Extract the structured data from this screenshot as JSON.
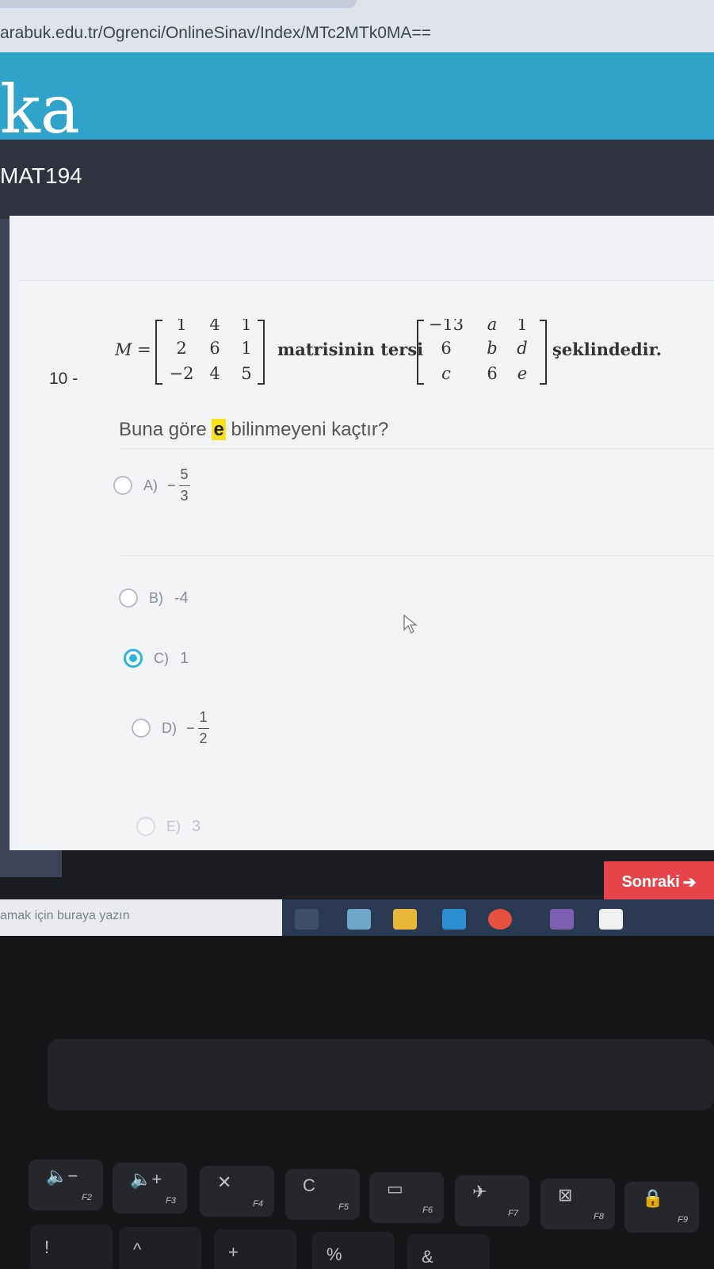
{
  "browser": {
    "url": "arabuk.edu.tr/Ogrenci/OnlineSinav/Index/MTc2MTk0MA=="
  },
  "header": {
    "logo_text": "ka",
    "course_code": "MAT194"
  },
  "question": {
    "number": "10 -",
    "matrix_label": "M =",
    "matrix_M": [
      [
        "1",
        "4",
        "1"
      ],
      [
        "2",
        "6",
        "1"
      ],
      [
        "−2",
        "4",
        "5"
      ]
    ],
    "text_middle": "matrisinin tersi",
    "matrix_inverse": [
      [
        "−13",
        "a",
        "1"
      ],
      [
        "6",
        "b",
        "d"
      ],
      [
        "c",
        "6",
        "e"
      ]
    ],
    "text_end": "şeklindedir.",
    "prompt_before": "Buna göre",
    "prompt_highlight": "e",
    "prompt_after": "bilinmeyeni kaçtır?"
  },
  "options": [
    {
      "letter": "A)",
      "value": "",
      "frac_sign": "−",
      "frac_num": "5",
      "frac_den": "3",
      "selected": false
    },
    {
      "letter": "B)",
      "value": "-4",
      "selected": false
    },
    {
      "letter": "C)",
      "value": "1",
      "selected": true
    },
    {
      "letter": "D)",
      "value": "",
      "frac_sign": "−",
      "frac_num": "1",
      "frac_den": "2",
      "selected": false
    },
    {
      "letter": "E)",
      "value": "3",
      "selected": false
    }
  ],
  "next_button": {
    "label": "Sonraki"
  },
  "taskbar": {
    "search_text": "amak için buraya yazın"
  },
  "keyboard": {
    "fkeys": [
      {
        "glyph": "🔈−",
        "label": "F2"
      },
      {
        "glyph": "🔈+",
        "label": "F3"
      },
      {
        "glyph": "✕",
        "label": "F4"
      },
      {
        "glyph": "C",
        "label": "F5"
      },
      {
        "glyph": "▭",
        "label": "F6"
      },
      {
        "glyph": "✈",
        "label": "F7"
      },
      {
        "glyph": "⊠",
        "label": "F8"
      },
      {
        "glyph": "🔒",
        "label": "F9"
      }
    ],
    "number_row": [
      {
        "glyph": "!"
      },
      {
        "glyph": "^"
      },
      {
        "glyph": "+"
      },
      {
        "glyph": "%"
      },
      {
        "glyph": "&"
      }
    ]
  },
  "colors": {
    "header_blue": "#2fa3c9",
    "accent_cyan": "#2cb6d4",
    "next_red": "#e5444a",
    "highlight_yellow": "#f7e11a"
  }
}
